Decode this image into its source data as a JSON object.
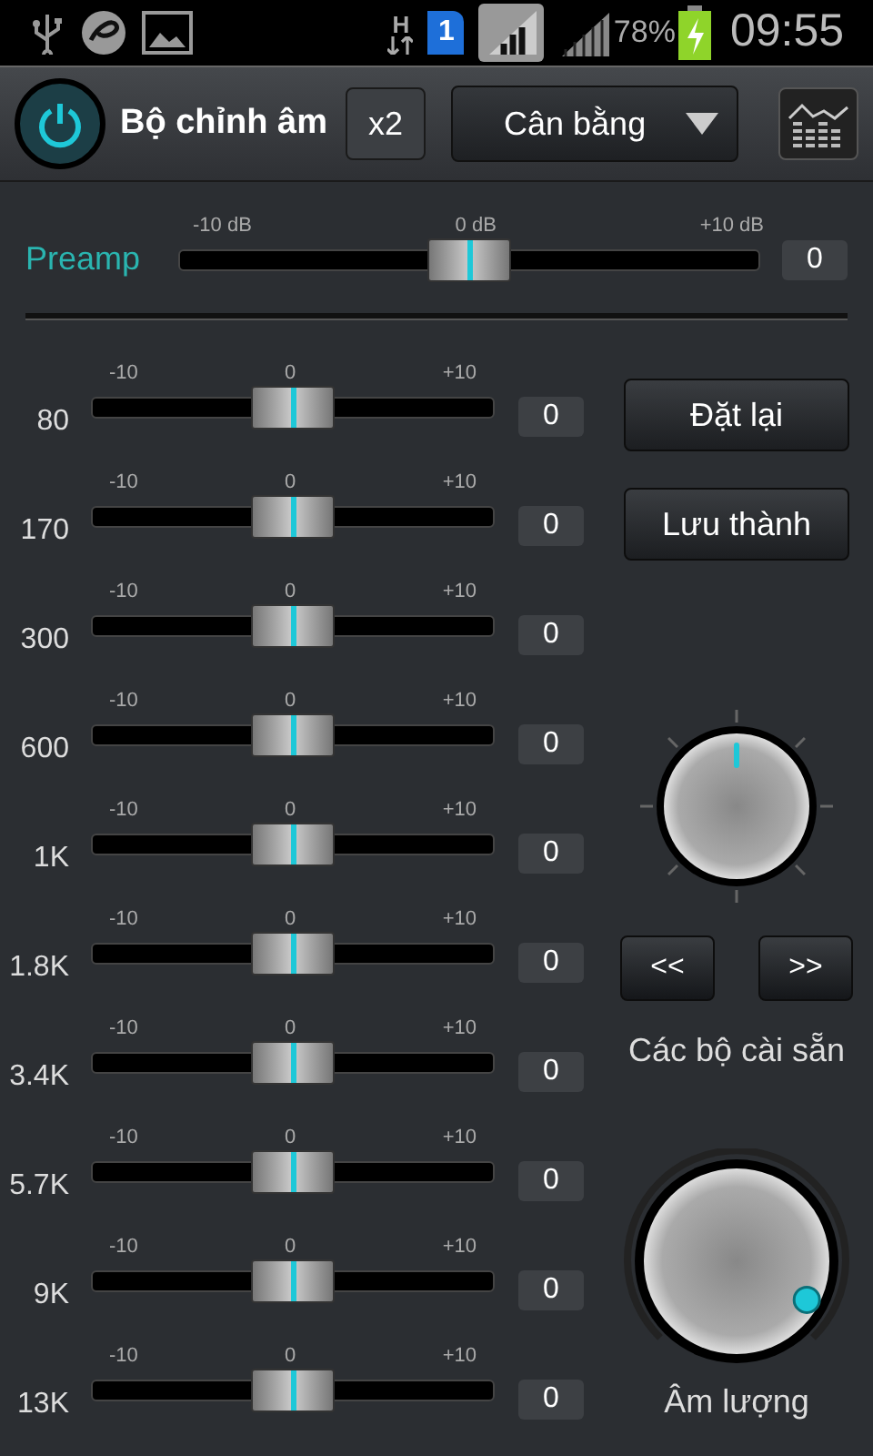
{
  "status_bar": {
    "network_type": "H",
    "sim": "1",
    "battery": "78%",
    "time": "09:55"
  },
  "toolbar": {
    "power_on": true,
    "title": "Bộ chỉnh âm",
    "multiplier": "x2",
    "preset": "Cân bằng"
  },
  "preamp": {
    "label": "Preamp",
    "ticks": [
      "-10 dB",
      "0 dB",
      "+10 dB"
    ],
    "level": 0.5,
    "value": "0"
  },
  "bands": [
    {
      "label": "80",
      "ticks": [
        "-10",
        "0",
        "+10"
      ],
      "level": 0.5,
      "value": "0"
    },
    {
      "label": "170",
      "ticks": [
        "-10",
        "0",
        "+10"
      ],
      "level": 0.5,
      "value": "0"
    },
    {
      "label": "300",
      "ticks": [
        "-10",
        "0",
        "+10"
      ],
      "level": 0.5,
      "value": "0"
    },
    {
      "label": "600",
      "ticks": [
        "-10",
        "0",
        "+10"
      ],
      "level": 0.5,
      "value": "0"
    },
    {
      "label": "1K",
      "ticks": [
        "-10",
        "0",
        "+10"
      ],
      "level": 0.5,
      "value": "0"
    },
    {
      "label": "1.8K",
      "ticks": [
        "-10",
        "0",
        "+10"
      ],
      "level": 0.5,
      "value": "0"
    },
    {
      "label": "3.4K",
      "ticks": [
        "-10",
        "0",
        "+10"
      ],
      "level": 0.5,
      "value": "0"
    },
    {
      "label": "5.7K",
      "ticks": [
        "-10",
        "0",
        "+10"
      ],
      "level": 0.5,
      "value": "0"
    },
    {
      "label": "9K",
      "ticks": [
        "-10",
        "0",
        "+10"
      ],
      "level": 0.5,
      "value": "0"
    },
    {
      "label": "13K",
      "ticks": [
        "-10",
        "0",
        "+10"
      ],
      "level": 0.5,
      "value": "0"
    }
  ],
  "side": {
    "reset_button": "Đặt lại",
    "save_button": "Lưu thành",
    "prev_button": "<<",
    "next_button": ">>",
    "presets_label": "Các bộ cài sẵn",
    "volume": {
      "label": "Âm lượng",
      "level": 0.94
    }
  }
}
